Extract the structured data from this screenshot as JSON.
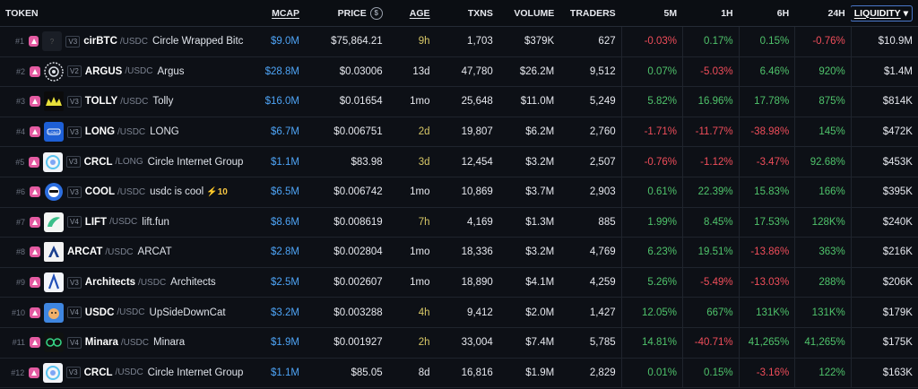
{
  "header": {
    "token": "TOKEN",
    "mcap": "MCAP",
    "price": "PRICE",
    "age": "AGE",
    "txns": "TXNS",
    "volume": "VOLUME",
    "traders": "TRADERS",
    "m5": "5M",
    "h1": "1H",
    "h6": "6H",
    "h24": "24H",
    "liquidity": "LIQUIDITY",
    "price_icon": "$"
  },
  "rows": [
    {
      "rank": "#1",
      "ver": "V3",
      "sym": "cirBTC",
      "pair": "/USDC",
      "name": "Circle Wrapped Bitc",
      "boost": "",
      "logo": "empty-icon",
      "mcap": "$9.0M",
      "price": "$75,864.21",
      "age": "9h",
      "txns": "1,703",
      "volume": "$379K",
      "traders": "627",
      "m5": "-0.03%",
      "h1": "0.17%",
      "h6": "0.15%",
      "h24": "-0.76%",
      "liq": "$10.9M"
    },
    {
      "rank": "#2",
      "ver": "V2",
      "sym": "ARGUS",
      "pair": "/USDC",
      "name": "Argus",
      "boost": "",
      "logo": "gear-icon",
      "mcap": "$28.8M",
      "price": "$0.03006",
      "age": "13d",
      "txns": "47,780",
      "volume": "$26.2M",
      "traders": "9,512",
      "m5": "0.07%",
      "h1": "-5.03%",
      "h6": "6.46%",
      "h24": "920%",
      "liq": "$1.4M"
    },
    {
      "rank": "#3",
      "ver": "V3",
      "sym": "TOLLY",
      "pair": "/USDC",
      "name": "Tolly",
      "boost": "",
      "logo": "crown-icon",
      "mcap": "$16.0M",
      "price": "$0.01654",
      "age": "1mo",
      "txns": "25,648",
      "volume": "$11.0M",
      "traders": "5,249",
      "m5": "5.82%",
      "h1": "16.96%",
      "h6": "17.78%",
      "h24": "875%",
      "liq": "$814K"
    },
    {
      "rank": "#4",
      "ver": "V3",
      "sym": "LONG",
      "pair": "/USDC",
      "name": "LONG",
      "boost": "",
      "logo": "long-icon",
      "mcap": "$6.7M",
      "price": "$0.006751",
      "age": "2d",
      "txns": "19,807",
      "volume": "$6.2M",
      "traders": "2,760",
      "m5": "-1.71%",
      "h1": "-11.77%",
      "h6": "-38.98%",
      "h24": "145%",
      "liq": "$472K"
    },
    {
      "rank": "#5",
      "ver": "V3",
      "sym": "CRCL",
      "pair": "/LONG",
      "name": "Circle Internet Group",
      "boost": "",
      "logo": "circle-icon",
      "mcap": "$1.1M",
      "price": "$83.98",
      "age": "3d",
      "txns": "12,454",
      "volume": "$3.2M",
      "traders": "2,507",
      "m5": "-0.76%",
      "h1": "-1.12%",
      "h6": "-3.47%",
      "h24": "92.68%",
      "liq": "$453K"
    },
    {
      "rank": "#6",
      "ver": "V3",
      "sym": "COOL",
      "pair": "/USDC",
      "name": "usdc is cool",
      "boost": "⚡10",
      "logo": "cool-icon",
      "mcap": "$6.5M",
      "price": "$0.006742",
      "age": "1mo",
      "txns": "10,869",
      "volume": "$3.7M",
      "traders": "2,903",
      "m5": "0.61%",
      "h1": "22.39%",
      "h6": "15.83%",
      "h24": "166%",
      "liq": "$395K"
    },
    {
      "rank": "#7",
      "ver": "V4",
      "sym": "LIFT",
      "pair": "/USDC",
      "name": "lift.fun",
      "boost": "",
      "logo": "lift-icon",
      "mcap": "$8.6M",
      "price": "$0.008619",
      "age": "7h",
      "txns": "4,169",
      "volume": "$1.3M",
      "traders": "885",
      "m5": "1.99%",
      "h1": "8.45%",
      "h6": "17.53%",
      "h24": "128K%",
      "liq": "$240K"
    },
    {
      "rank": "#8",
      "ver": "",
      "sym": "ARCAT",
      "pair": "/USDC",
      "name": "ARCAT",
      "boost": "",
      "logo": "arcat-icon",
      "mcap": "$2.8M",
      "price": "$0.002804",
      "age": "1mo",
      "txns": "18,336",
      "volume": "$3.2M",
      "traders": "4,769",
      "m5": "6.23%",
      "h1": "19.51%",
      "h6": "-13.86%",
      "h24": "363%",
      "liq": "$216K"
    },
    {
      "rank": "#9",
      "ver": "V3",
      "sym": "Architects",
      "pair": "/USDC",
      "name": "Architects",
      "boost": "",
      "logo": "arch-icon",
      "mcap": "$2.5M",
      "price": "$0.002607",
      "age": "1mo",
      "txns": "18,890",
      "volume": "$4.1M",
      "traders": "4,259",
      "m5": "5.26%",
      "h1": "-5.49%",
      "h6": "-13.03%",
      "h24": "288%",
      "liq": "$206K"
    },
    {
      "rank": "#10",
      "ver": "V4",
      "sym": "USDC",
      "pair": "/USDC",
      "name": "UpSideDownCat",
      "boost": "",
      "logo": "cat-icon",
      "mcap": "$3.2M",
      "price": "$0.003288",
      "age": "4h",
      "txns": "9,412",
      "volume": "$2.0M",
      "traders": "1,427",
      "m5": "12.05%",
      "h1": "667%",
      "h6": "131K%",
      "h24": "131K%",
      "liq": "$179K"
    },
    {
      "rank": "#11",
      "ver": "V4",
      "sym": "Minara",
      "pair": "/USDC",
      "name": "Minara",
      "boost": "",
      "logo": "minara-icon",
      "mcap": "$1.9M",
      "price": "$0.001927",
      "age": "2h",
      "txns": "33,004",
      "volume": "$7.4M",
      "traders": "5,785",
      "m5": "14.81%",
      "h1": "-40.71%",
      "h6": "41,265%",
      "h24": "41,265%",
      "liq": "$175K"
    },
    {
      "rank": "#12",
      "ver": "V3",
      "sym": "CRCL",
      "pair": "/USDC",
      "name": "Circle Internet Group",
      "boost": "",
      "logo": "circle-icon",
      "mcap": "$1.1M",
      "price": "$85.05",
      "age": "8d",
      "txns": "16,816",
      "volume": "$1.9M",
      "traders": "2,829",
      "m5": "0.01%",
      "h1": "0.15%",
      "h6": "-3.16%",
      "h24": "122%",
      "liq": "$163K"
    }
  ],
  "colors": {
    "positive": "#4fc36b",
    "negative": "#f04d5a",
    "mcap": "#4da3f5",
    "age": "#d7c767",
    "badge": "#e45ba2"
  }
}
